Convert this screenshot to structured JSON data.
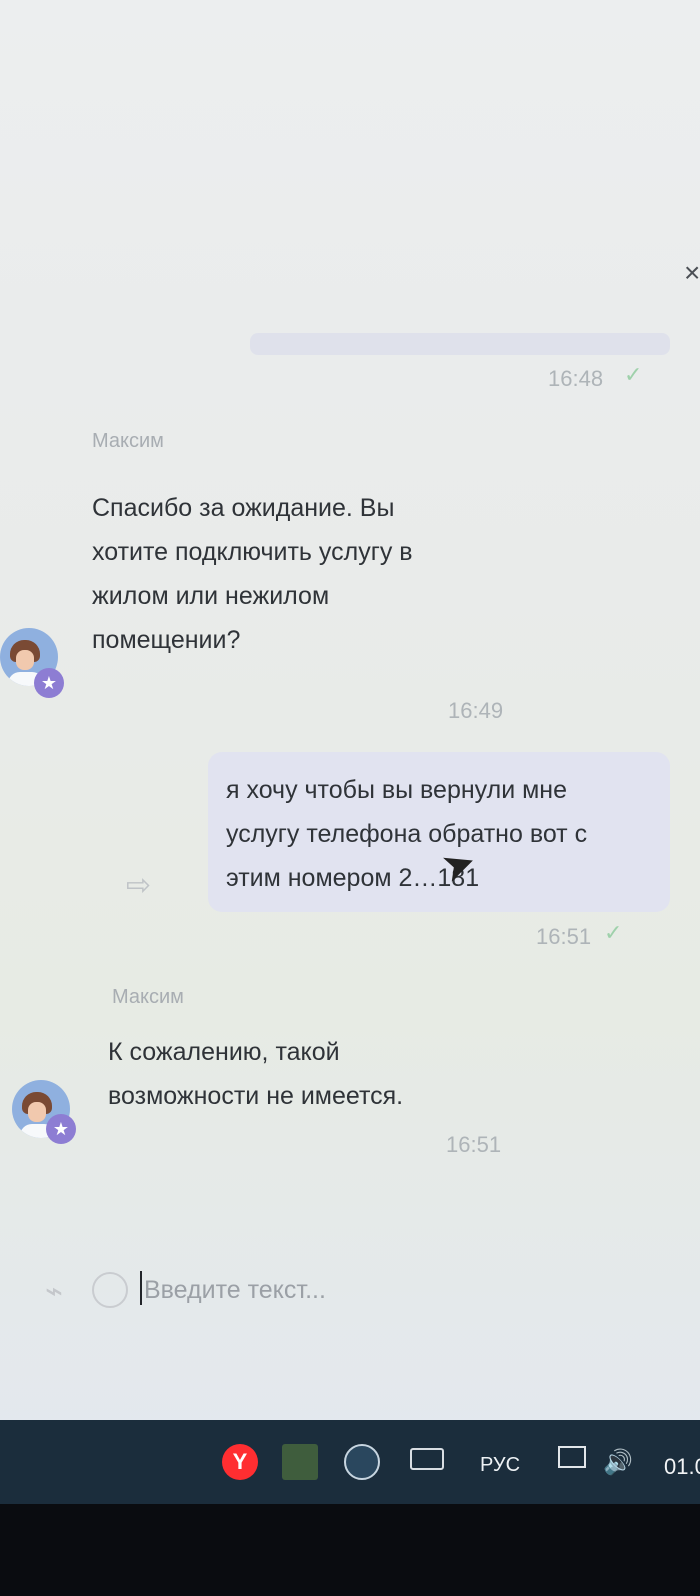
{
  "window": {
    "close_icon": "close-icon"
  },
  "messages": [
    {
      "time": "16:48",
      "read": true
    },
    {
      "sender": "Максим",
      "lines": [
        "Спасибо за ожидание. Вы",
        "хотите подключить услугу в",
        "жилом или нежилом",
        "помещении?"
      ],
      "time": "16:49"
    },
    {
      "lines": [
        "я хочу чтобы вы вернули мне",
        "услугу телефона обратно вот с",
        "этим номером 2…181"
      ],
      "time": "16:51",
      "read": true
    },
    {
      "sender": "Максим",
      "lines": [
        "К сожалению, такой",
        "возможности не имеется."
      ],
      "time": "16:51"
    }
  ],
  "composer": {
    "placeholder": "Введите текст..."
  },
  "taskbar": {
    "language": "РУС",
    "date_partial": "01.0"
  }
}
